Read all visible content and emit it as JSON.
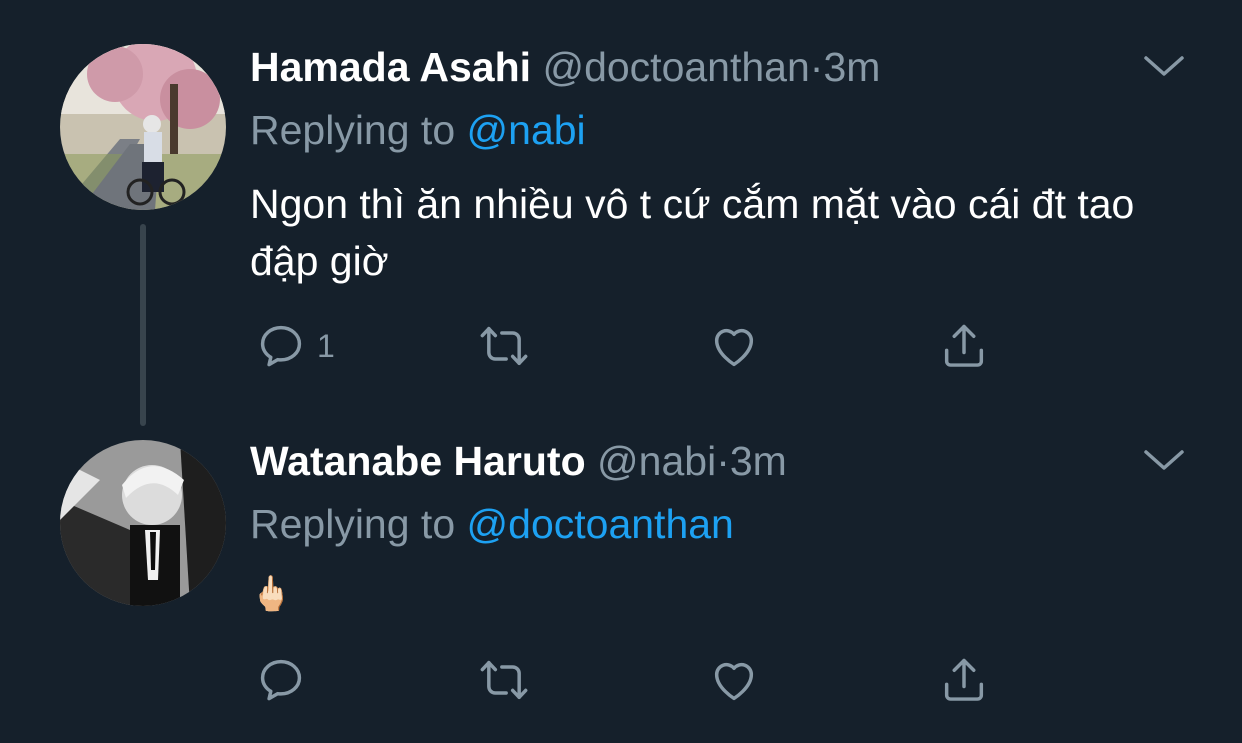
{
  "tweets": [
    {
      "name": "Hamada Asahi",
      "handle": "@doctoanthan",
      "separator": "·",
      "time": "3m",
      "replying_prefix": "Replying to",
      "replying_to": "@nabi",
      "text": "Ngon thì ăn nhiều vô t cứ cắm mặt vào cái đt tao đập giờ",
      "reply_count": "1"
    },
    {
      "name": "Watanabe Haruto",
      "handle": "@nabi",
      "separator": "·",
      "time": "3m",
      "replying_prefix": "Replying to",
      "replying_to": "@doctoanthan",
      "text": "🖕🏻",
      "reply_count": ""
    }
  ],
  "colors": {
    "background": "#15202b",
    "secondary_text": "#8899a6",
    "mention": "#1da1f2",
    "thread_line": "#38444d"
  },
  "icons": [
    "chevron-down-icon",
    "reply-icon",
    "retweet-icon",
    "like-icon",
    "share-icon"
  ]
}
